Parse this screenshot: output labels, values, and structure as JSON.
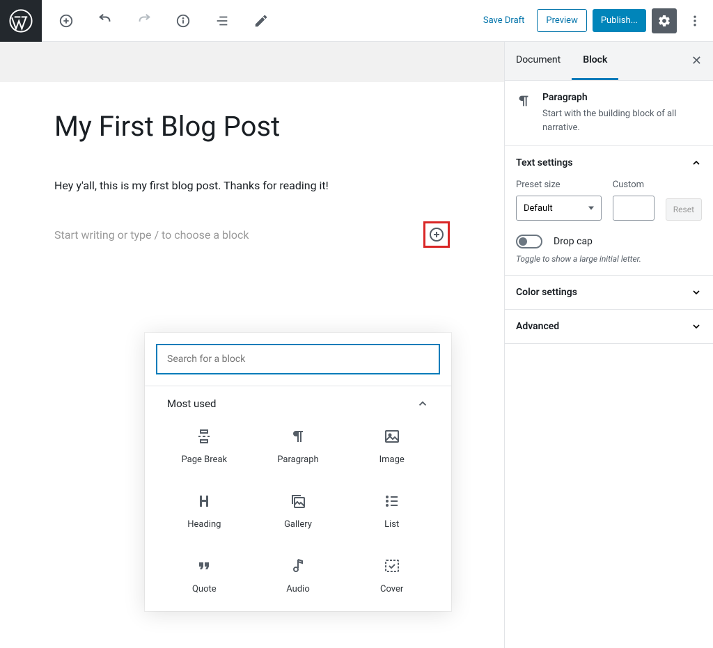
{
  "toolbar": {
    "save_draft": "Save Draft",
    "preview": "Preview",
    "publish": "Publish..."
  },
  "editor": {
    "title": "My First Blog Post",
    "paragraph": "Hey y'all, this is my first blog post. Thanks for reading it!",
    "placeholder": "Start writing or type / to choose a block"
  },
  "inserter": {
    "search_placeholder": "Search for a block",
    "section_label": "Most used",
    "blocks": {
      "page_break": "Page Break",
      "paragraph": "Paragraph",
      "image": "Image",
      "heading": "Heading",
      "gallery": "Gallery",
      "list": "List",
      "quote": "Quote",
      "audio": "Audio",
      "cover": "Cover"
    }
  },
  "sidebar": {
    "tabs": {
      "document": "Document",
      "block": "Block"
    },
    "block_title": "Paragraph",
    "block_desc": "Start with the building block of all narrative.",
    "panels": {
      "text_settings": "Text settings",
      "color_settings": "Color settings",
      "advanced": "Advanced"
    },
    "preset_size_label": "Preset size",
    "preset_size_value": "Default",
    "custom_label": "Custom",
    "reset": "Reset",
    "drop_cap": "Drop cap",
    "drop_cap_help": "Toggle to show a large initial letter."
  }
}
